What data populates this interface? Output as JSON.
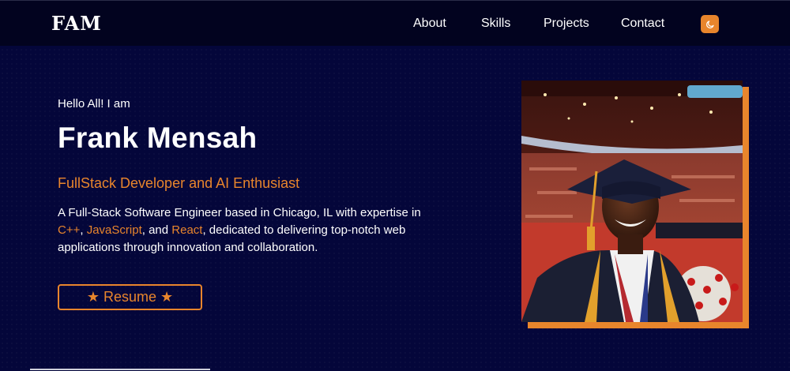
{
  "nav": {
    "logo": "FAM",
    "links": [
      "About",
      "Skills",
      "Projects",
      "Contact"
    ],
    "theme_toggle_icon": "moon-icon",
    "accent": "#e8852c"
  },
  "hero": {
    "greeting": "Hello All! I am",
    "name": "Frank Mensah",
    "role": "FullStack Developer and AI Enthusiast",
    "bio": {
      "part1": "A Full-Stack Software Engineer based in Chicago, IL with expertise in ",
      "skill1": "C++",
      "sep1": ", ",
      "skill2": "JavaScript",
      "sep2": ", and ",
      "skill3": "React",
      "part2": ", dedicated to delivering top-notch web applications through innovation and collaboration."
    },
    "resume_label": "★ Resume ★"
  },
  "colors": {
    "background": "#04063a",
    "navbar": "#02031f",
    "accent": "#e8852c"
  }
}
